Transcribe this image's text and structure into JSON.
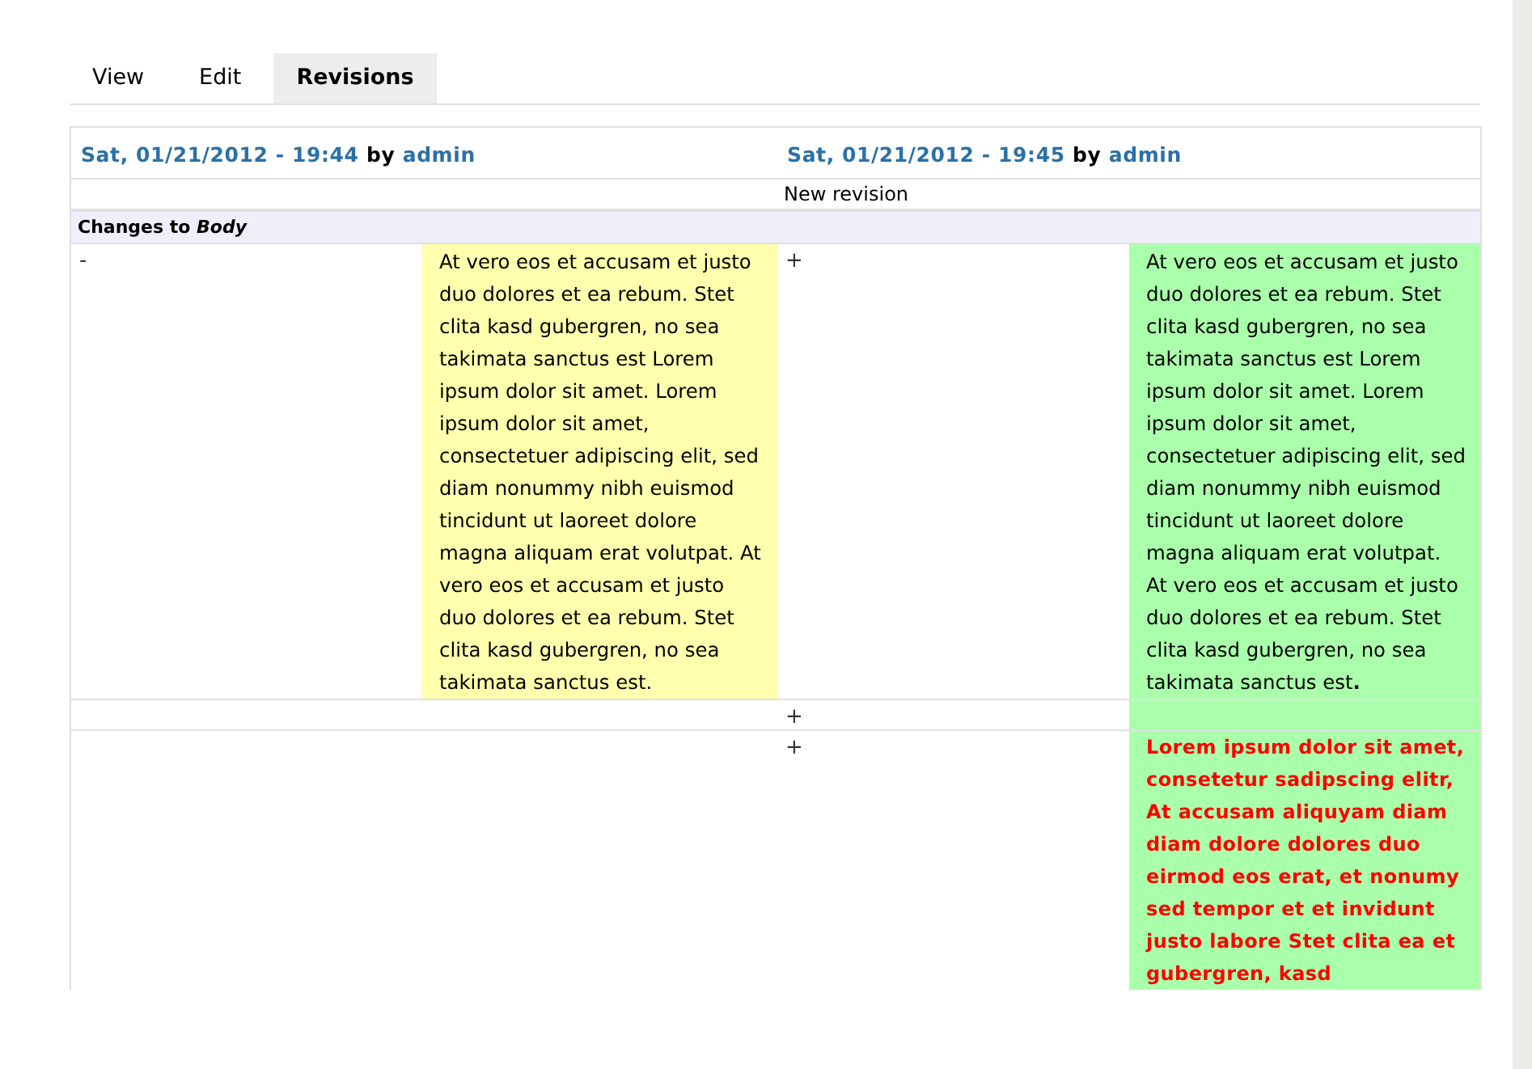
{
  "tabs": [
    {
      "label": "View",
      "selected": false
    },
    {
      "label": "Edit",
      "selected": false
    },
    {
      "label": "Revisions",
      "selected": true
    }
  ],
  "revisions": [
    {
      "date": "Sat, 01/21/2012 - 19:44",
      "by": "by",
      "author": "admin"
    },
    {
      "date": "Sat, 01/21/2012 - 19:45",
      "by": "by",
      "author": "admin"
    }
  ],
  "revision_log": "New revision",
  "section": "Changes to *Body*",
  "diff_rows": [
    {
      "cells": [
        {
          "kind": "marker",
          "text": "-"
        },
        {
          "kind": "deleted",
          "text": "At vero eos et accusam et justo duo dolores et ea rebum. Stet clita kasd gubergren, no sea takimata sanctus est Lorem ipsum dolor sit amet. Lorem ipsum dolor sit amet, consectetuer adipiscing elit, sed diam nonummy nibh euismod tincidunt ut laoreet dolore magna aliquam erat volutpat. At vero eos et accusam et justo duo dolores et ea rebum. Stet clita kasd gubergren, no sea takimata sanctus est."
        },
        {
          "kind": "marker",
          "text": "+"
        },
        {
          "kind": "added",
          "text": "At vero eos et accusam et justo duo dolores et ea rebum. Stet clita kasd gubergren, no sea takimata sanctus est Lorem ipsum dolor sit amet. Lorem ipsum dolor sit amet, consectetuer adipiscing elit, sed diam nonummy nibh euismod tincidunt ut laoreet dolore magna aliquam erat volutpat. At vero eos et accusam et justo duo dolores et ea rebum. Stet clita kasd gubergren, no sea takimata sanctus est**.**"
        }
      ]
    },
    {
      "cells": [
        {
          "kind": "empty"
        },
        {
          "kind": "empty"
        },
        {
          "kind": "marker",
          "text": "+"
        },
        {
          "kind": "added"
        }
      ]
    },
    {
      "cells": [
        {
          "kind": "empty"
        },
        {
          "kind": "empty"
        },
        {
          "kind": "marker",
          "text": "+"
        },
        {
          "kind": "added-new",
          "text": "Lorem ipsum dolor sit amet, consetetur sadipscing elitr, At accusam aliquyam diam diam dolore dolores duo eirmod eos erat, et nonumy sed tempor et et invidunt justo labore Stet clita ea et gubergren, kasd"
        }
      ]
    }
  ]
}
